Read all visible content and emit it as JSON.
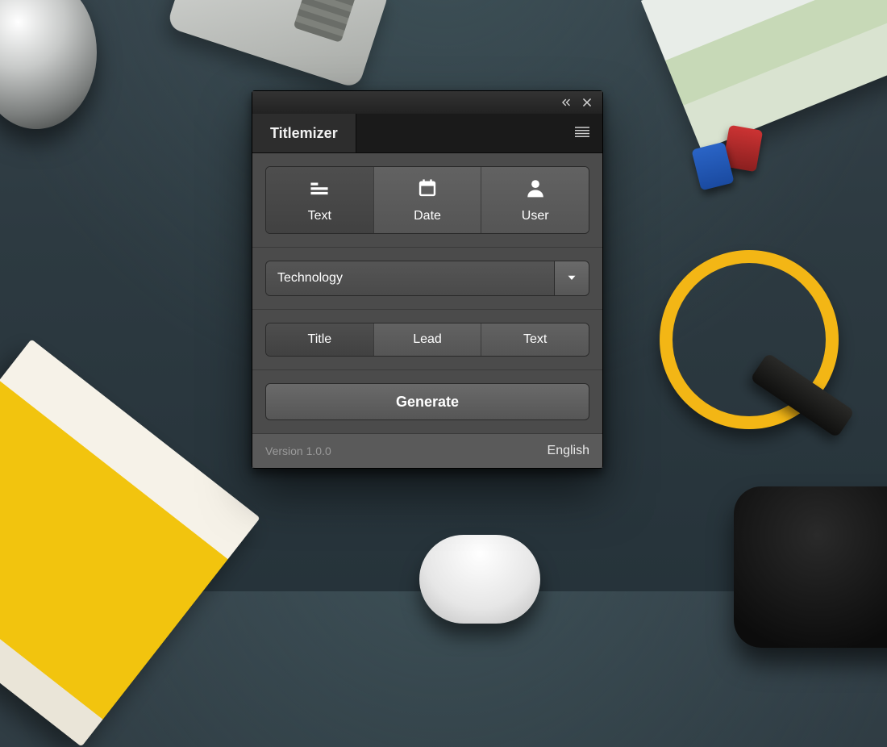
{
  "app": {
    "title": "Titlemizer"
  },
  "window": {
    "collapse_icon": "chevrons-left",
    "close_icon": "close",
    "menu_icon": "menu-lines"
  },
  "mode_tabs": {
    "active_index": 0,
    "items": [
      {
        "label": "Text",
        "icon": "text-lines"
      },
      {
        "label": "Date",
        "icon": "calendar"
      },
      {
        "label": "User",
        "icon": "user"
      }
    ]
  },
  "category_select": {
    "value": "Technology"
  },
  "output_tabs": {
    "active_index": 0,
    "items": [
      {
        "label": "Title"
      },
      {
        "label": "Lead"
      },
      {
        "label": "Text"
      }
    ]
  },
  "actions": {
    "generate_label": "Generate"
  },
  "footer": {
    "version_label": "Version 1.0.0",
    "language_label": "English"
  }
}
